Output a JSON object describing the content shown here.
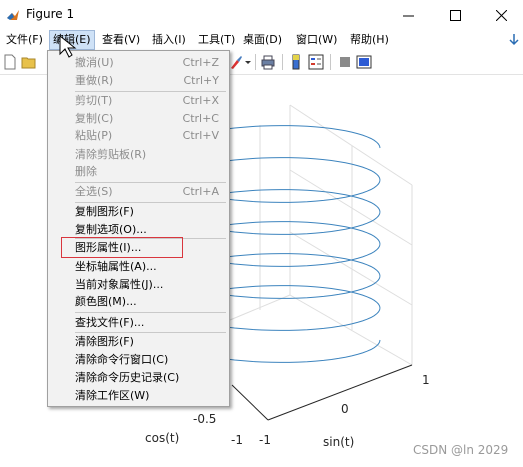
{
  "window": {
    "title": "Figure 1"
  },
  "menubar": {
    "items": [
      {
        "label": "文件(F)"
      },
      {
        "label": "编辑(E)"
      },
      {
        "label": "查看(V)"
      },
      {
        "label": "插入(I)"
      },
      {
        "label": "工具(T)"
      },
      {
        "label": "桌面(D)"
      },
      {
        "label": "窗口(W)"
      },
      {
        "label": "帮助(H)"
      }
    ]
  },
  "edit_menu": {
    "items": [
      {
        "label": "撤消(U)",
        "shortcut": "Ctrl+Z"
      },
      {
        "label": "重做(R)",
        "shortcut": "Ctrl+Y"
      },
      {
        "label": "剪切(T)",
        "shortcut": "Ctrl+X"
      },
      {
        "label": "复制(C)",
        "shortcut": "Ctrl+C"
      },
      {
        "label": "粘贴(P)",
        "shortcut": "Ctrl+V"
      },
      {
        "label": "清除剪贴板(R)",
        "shortcut": ""
      },
      {
        "label": "删除",
        "shortcut": ""
      },
      {
        "label": "全选(S)",
        "shortcut": "Ctrl+A"
      },
      {
        "label": "复制图形(F)",
        "shortcut": ""
      },
      {
        "label": "复制选项(O)...",
        "shortcut": ""
      },
      {
        "label": "图形属性(I)...",
        "shortcut": ""
      },
      {
        "label": "坐标轴属性(A)...",
        "shortcut": ""
      },
      {
        "label": "当前对象属性(J)...",
        "shortcut": ""
      },
      {
        "label": "颜色图(M)...",
        "shortcut": ""
      },
      {
        "label": "查找文件(F)...",
        "shortcut": ""
      },
      {
        "label": "清除图形(F)",
        "shortcut": ""
      },
      {
        "label": "清除命令行窗口(C)",
        "shortcut": ""
      },
      {
        "label": "清除命令历史记录(C)",
        "shortcut": ""
      },
      {
        "label": "清除工作区(W)",
        "shortcut": ""
      }
    ]
  },
  "plot": {
    "xlabel": "cos(t)",
    "ylabel": "sin(t)",
    "x_tick_labels": [
      "-1",
      "-0.5"
    ],
    "y_tick_labels": [
      "-1",
      "0",
      "1"
    ],
    "line_color": "#3d84be"
  },
  "watermark": "CSDN @ln 2029"
}
